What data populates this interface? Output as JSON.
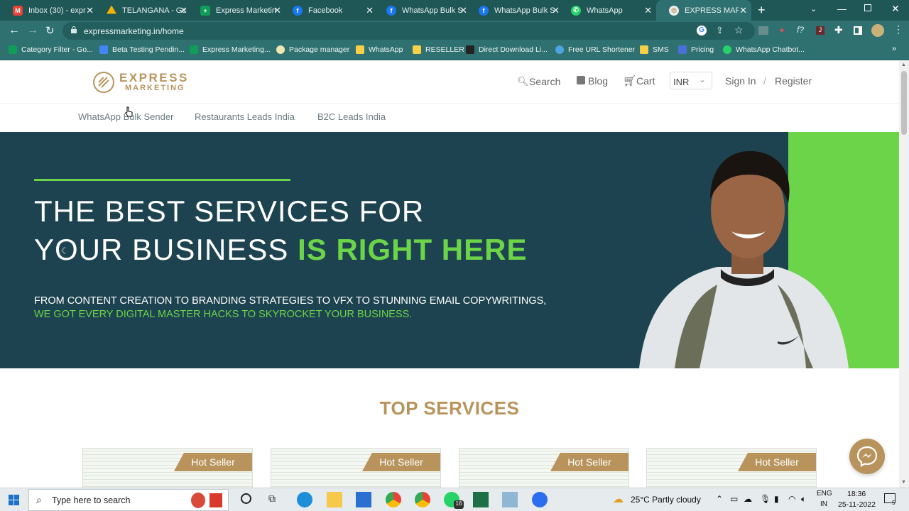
{
  "browser": {
    "tabs": [
      {
        "title": "Inbox (30) - expr",
        "icon": "gmail-icon",
        "color": "#ea4335",
        "active": false
      },
      {
        "title": "TELANGANA - Gc",
        "icon": "google-drive-icon",
        "color": "#f4b400",
        "active": false
      },
      {
        "title": "Express Marketin",
        "icon": "google-sheets-icon",
        "color": "#0f9d58",
        "active": false
      },
      {
        "title": "Facebook",
        "icon": "facebook-icon",
        "color": "#1877f2",
        "active": false
      },
      {
        "title": "WhatsApp Bulk S",
        "icon": "facebook-icon",
        "color": "#1877f2",
        "active": false
      },
      {
        "title": "WhatsApp Bulk S",
        "icon": "facebook-icon",
        "color": "#1877f2",
        "active": false
      },
      {
        "title": "WhatsApp",
        "icon": "whatsapp-icon",
        "color": "#25d366",
        "active": false
      },
      {
        "title": "EXPRESS MARKET",
        "icon": "site-favicon-icon",
        "color": "#b8945c",
        "active": true
      }
    ],
    "url": "expressmarketing.in/home",
    "bookmarks": [
      {
        "label": "Category Filter - Go...",
        "color": "#0f9d58"
      },
      {
        "label": "Beta Testing Pendin...",
        "color": "#4285f4"
      },
      {
        "label": "Express Marketing...",
        "color": "#0f9d58"
      },
      {
        "label": "Package manager",
        "color": "#f0e6b4"
      },
      {
        "label": "WhatsApp",
        "color": "#f7d047"
      },
      {
        "label": "RESELLER",
        "color": "#f7d047"
      },
      {
        "label": "Direct Download Li...",
        "color": "#222222"
      },
      {
        "label": "Free URL Shortener",
        "color": "#4fa3e0"
      },
      {
        "label": "SMS",
        "color": "#f7d047"
      },
      {
        "label": "Pricing",
        "color": "#4a6fd6"
      },
      {
        "label": "WhatsApp Chatbot...",
        "color": "#25d366"
      }
    ]
  },
  "site": {
    "logo": {
      "line1": "EXPRESS",
      "line2": "MARKETING"
    },
    "nav": {
      "search": "Search",
      "blog": "Blog",
      "cart": "Cart",
      "currency": "INR",
      "sign_in": "Sign In",
      "separator": "/",
      "register": "Register"
    },
    "menu": [
      "WhatsApp Bulk Sender",
      "Restaurants Leads India",
      "B2C Leads India"
    ],
    "hero": {
      "line1": "THE BEST SERVICES FOR",
      "line2_plain": "YOUR BUSINESS ",
      "line2_highlight": "IS RIGHT HERE",
      "sub1": "FROM CONTENT CREATION TO BRANDING STRATEGIES TO VFX TO STUNNING EMAIL COPYWRITINGS,",
      "sub2": "WE GOT EVERY DIGITAL MASTER HACKS TO SKYROCKET YOUR BUSINESS."
    },
    "services_title": "TOP SERVICES",
    "badges": [
      "Hot Seller",
      "Hot Seller",
      "Hot Seller",
      "Hot Seller"
    ],
    "colors": {
      "accent_gold": "#b8945c",
      "hero_bg": "#1d4350",
      "hero_green": "#6bd448"
    }
  },
  "taskbar": {
    "search_placeholder": "Type here to search",
    "weather": "25°C  Partly cloudy",
    "language": "ENG",
    "region": "IN",
    "time": "18:36",
    "date": "25-11-2022",
    "whatsapp_badge": "16",
    "notifications": "5"
  }
}
